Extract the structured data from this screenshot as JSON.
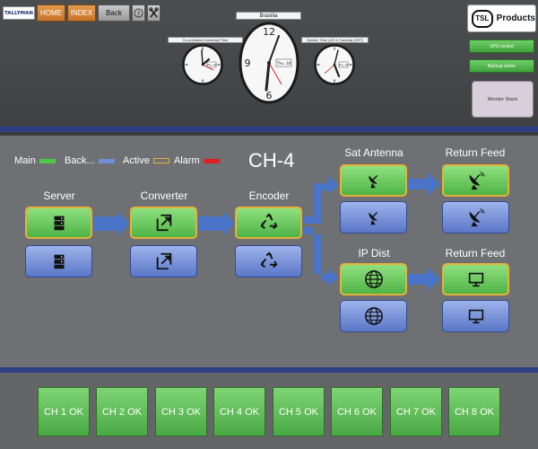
{
  "header": {
    "logo_text": "TALLYMAN",
    "home_label": "HOME",
    "index_label": "INDEX",
    "back_label": "Back",
    "help_icon": "help-icon",
    "settings_icon": "tools-icon",
    "clocks": [
      {
        "label": "Co-ordinated Universal Time",
        "date": "Thu 18"
      },
      {
        "label": "Brasilia",
        "date": "Thu 18"
      },
      {
        "label": "System Time (US & Canada) (DST)",
        "date": "Thu 18"
      }
    ],
    "brand": {
      "badge": "TSL",
      "text": "Products"
    },
    "status": [
      "SPG locked",
      "Backup active"
    ],
    "monitor_stack_label": "Monitor Stack"
  },
  "legend": [
    {
      "label": "Main",
      "color": "#4ec84a"
    },
    {
      "label": "Back...",
      "color": "#6f8fd8"
    },
    {
      "label": "Active",
      "color": "#e5b238"
    },
    {
      "label": "Alarm",
      "color": "#e02020"
    }
  ],
  "channel_title": "CH-4",
  "nodes": [
    {
      "label": "Server",
      "icon": "server-icon"
    },
    {
      "label": "Converter",
      "icon": "converter-icon"
    },
    {
      "label": "Encoder",
      "icon": "recycle-icon"
    },
    {
      "label": "Sat Antenna",
      "icon": "satellite-dish-icon"
    },
    {
      "label": "Return Feed",
      "icon": "satellite-dish-icon"
    },
    {
      "label": "IP Dist",
      "icon": "globe-icon"
    },
    {
      "label": "Return Feed",
      "icon": "monitor-icon"
    }
  ],
  "channels": [
    "CH 1 OK",
    "CH 2 OK",
    "CH 3 OK",
    "CH 4 OK",
    "CH 5 OK",
    "CH 6 OK",
    "CH 7 OK",
    "CH 8 OK"
  ],
  "colors": {
    "main": "#4ec84a",
    "backup": "#6f8fd8",
    "active_border": "#e5b238",
    "alarm": "#e02020",
    "arrow": "#4a74c8",
    "accent_bar": "#2f3f86"
  }
}
